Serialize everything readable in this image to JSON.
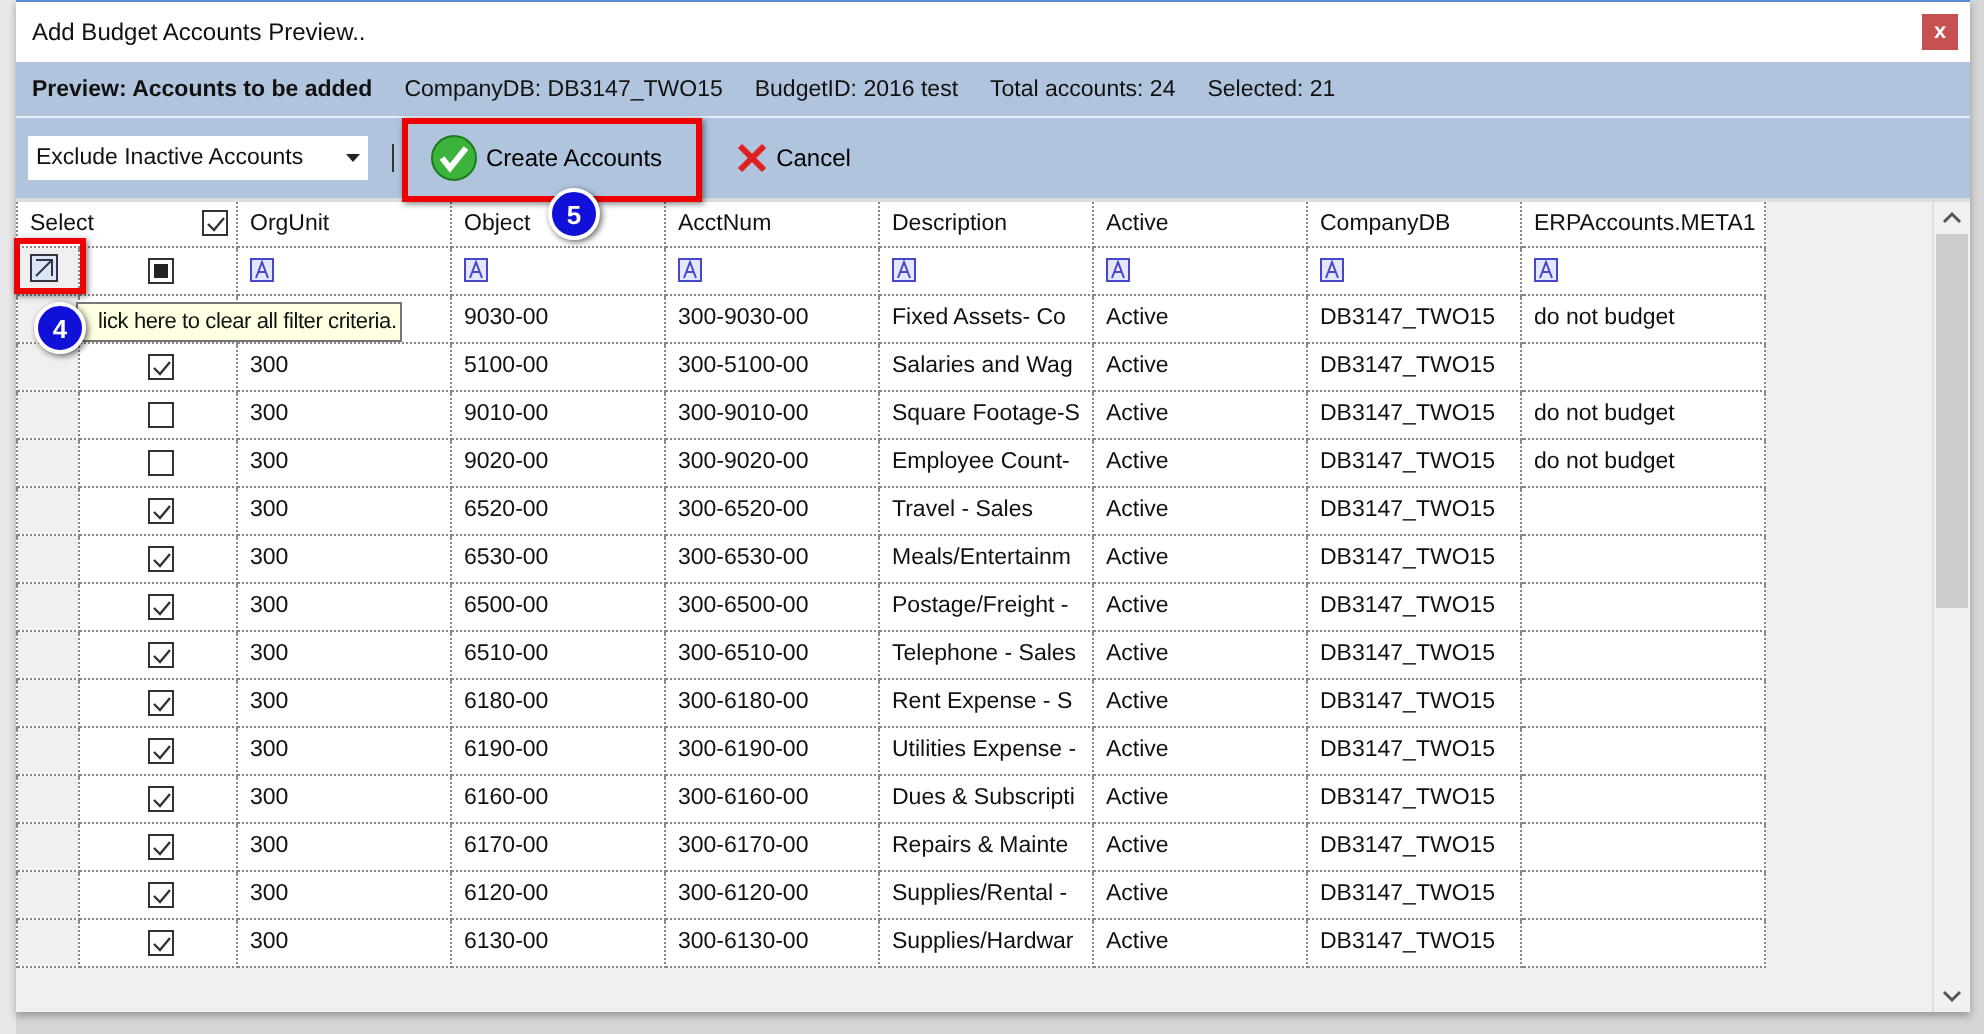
{
  "window": {
    "title": "Add Budget Accounts Preview..",
    "close": "x"
  },
  "info_bar": {
    "heading": "Preview: Accounts to be added",
    "company_db": "CompanyDB: DB3147_TWO15",
    "budget_id": "BudgetID: 2016 test",
    "total": "Total accounts: 24",
    "selected": "Selected: 21"
  },
  "toolbar": {
    "filter_dropdown": {
      "value": "Exclude Inactive Accounts"
    },
    "create_button": "Create Accounts",
    "cancel_button": "Cancel"
  },
  "annotations": [
    {
      "number": "4"
    },
    {
      "number": "5"
    }
  ],
  "tooltip": "lick here to clear all filter criteria.",
  "table": {
    "select_label": "Select",
    "header_checked": true,
    "select_filter_indeterminate": true,
    "columns": [
      "OrgUnit",
      "Object",
      "AcctNum",
      "Description",
      "Active",
      "CompanyDB",
      "ERPAccounts.META1"
    ],
    "rows": [
      {
        "object": "9030-00",
        "acct_num": "300-9030-00",
        "description": "Fixed Assets- Co",
        "active": "Active",
        "company_db": "DB3147_TWO15",
        "meta1": "do not budget"
      },
      {
        "checked": true,
        "org_unit": "300",
        "object": "5100-00",
        "acct_num": "300-5100-00",
        "description": "Salaries and Wag",
        "active": "Active",
        "company_db": "DB3147_TWO15"
      },
      {
        "checked": false,
        "org_unit": "300",
        "object": "9010-00",
        "acct_num": "300-9010-00",
        "description": "Square Footage-S",
        "active": "Active",
        "company_db": "DB3147_TWO15",
        "meta1": "do not budget"
      },
      {
        "checked": false,
        "org_unit": "300",
        "object": "9020-00",
        "acct_num": "300-9020-00",
        "description": "Employee Count-",
        "active": "Active",
        "company_db": "DB3147_TWO15",
        "meta1": "do not budget"
      },
      {
        "checked": true,
        "org_unit": "300",
        "object": "6520-00",
        "acct_num": "300-6520-00",
        "description": "Travel - Sales",
        "active": "Active",
        "company_db": "DB3147_TWO15"
      },
      {
        "checked": true,
        "org_unit": "300",
        "object": "6530-00",
        "acct_num": "300-6530-00",
        "description": "Meals/Entertainm",
        "active": "Active",
        "company_db": "DB3147_TWO15"
      },
      {
        "checked": true,
        "org_unit": "300",
        "object": "6500-00",
        "acct_num": "300-6500-00",
        "description": "Postage/Freight -",
        "active": "Active",
        "company_db": "DB3147_TWO15"
      },
      {
        "checked": true,
        "org_unit": "300",
        "object": "6510-00",
        "acct_num": "300-6510-00",
        "description": "Telephone - Sales",
        "active": "Active",
        "company_db": "DB3147_TWO15"
      },
      {
        "checked": true,
        "org_unit": "300",
        "object": "6180-00",
        "acct_num": "300-6180-00",
        "description": "Rent Expense - S",
        "active": "Active",
        "company_db": "DB3147_TWO15"
      },
      {
        "checked": true,
        "org_unit": "300",
        "object": "6190-00",
        "acct_num": "300-6190-00",
        "description": "Utilities Expense -",
        "active": "Active",
        "company_db": "DB3147_TWO15"
      },
      {
        "checked": true,
        "org_unit": "300",
        "object": "6160-00",
        "acct_num": "300-6160-00",
        "description": "Dues & Subscripti",
        "active": "Active",
        "company_db": "DB3147_TWO15"
      },
      {
        "checked": true,
        "org_unit": "300",
        "object": "6170-00",
        "acct_num": "300-6170-00",
        "description": "Repairs & Mainte",
        "active": "Active",
        "company_db": "DB3147_TWO15"
      },
      {
        "checked": true,
        "org_unit": "300",
        "object": "6120-00",
        "acct_num": "300-6120-00",
        "description": "Supplies/Rental -",
        "active": "Active",
        "company_db": "DB3147_TWO15"
      },
      {
        "checked": true,
        "org_unit": "300",
        "object": "6130-00",
        "acct_num": "300-6130-00",
        "description": "Supplies/Hardwar",
        "active": "Active",
        "company_db": "DB3147_TWO15"
      }
    ]
  }
}
